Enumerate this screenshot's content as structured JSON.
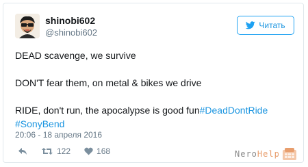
{
  "tweet": {
    "display_name": "shinobi602",
    "handle": "@shinobi602",
    "follow_label": "Читать",
    "lines": [
      "DEAD scavenge, we survive",
      "DON'T fear them, on metal & bikes we drive",
      "RIDE, don't run, the apocalypse is good fun"
    ],
    "hashtags": [
      "#DeadDontRide",
      "#SonyBend"
    ],
    "timestamp": "20:06 - 18 апреля 2016",
    "retweets": "122",
    "likes": "168"
  },
  "watermark": {
    "part1": "Nero",
    "part2": "Help"
  },
  "colors": {
    "link": "#1b95e0",
    "border": "#e1e8ed",
    "muted": "#657786"
  },
  "icons": [
    "twitter-bird-icon",
    "reply-icon",
    "retweet-icon",
    "heart-icon",
    "avatar-image",
    "watermark-logo-icon"
  ]
}
